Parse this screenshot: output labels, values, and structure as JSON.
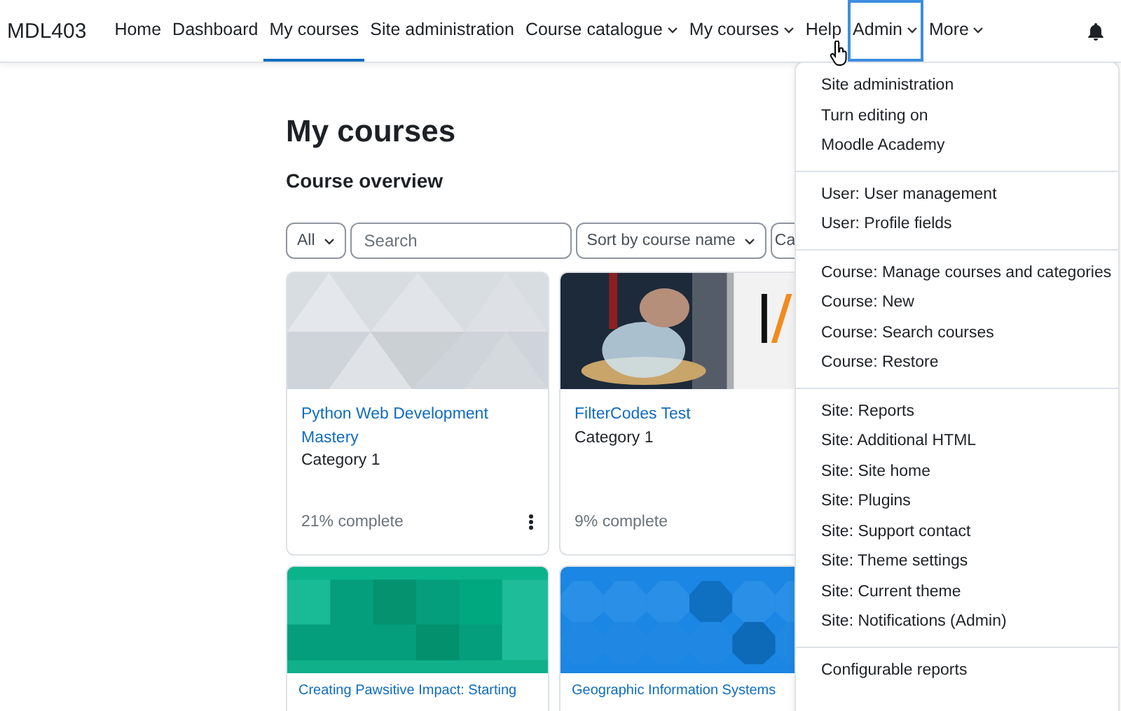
{
  "brand": "MDL403",
  "nav": [
    {
      "label": "Home",
      "dropdown": false,
      "selected": false,
      "focused": false
    },
    {
      "label": "Dashboard",
      "dropdown": false,
      "selected": false,
      "focused": false
    },
    {
      "label": "My courses",
      "dropdown": false,
      "selected": true,
      "focused": false
    },
    {
      "label": "Site administration",
      "dropdown": false,
      "selected": false,
      "focused": false
    },
    {
      "label": "Course catalogue",
      "dropdown": true,
      "selected": false,
      "focused": false
    },
    {
      "label": "My courses",
      "dropdown": true,
      "selected": false,
      "focused": false
    },
    {
      "label": "Help",
      "dropdown": false,
      "selected": false,
      "focused": false
    },
    {
      "label": "Admin",
      "dropdown": true,
      "selected": false,
      "focused": true
    },
    {
      "label": "More",
      "dropdown": true,
      "selected": false,
      "focused": false
    }
  ],
  "page": {
    "title": "My courses",
    "subtitle": "Course overview"
  },
  "filters": [
    {
      "kind": "select",
      "label": "All"
    },
    {
      "kind": "search",
      "placeholder": "Search"
    },
    {
      "kind": "select",
      "label": "Sort by course name"
    },
    {
      "kind": "select",
      "label": "Ca"
    }
  ],
  "courses": [
    {
      "kind": "triangles",
      "title": "Python Web Development Mastery",
      "category": "Category 1",
      "progress": "21% complete"
    },
    {
      "title": "FilterCodes Test",
      "category": "Category 1",
      "progress": "9% complete"
    },
    {
      "kind": "squares",
      "title": "Creating Pawsitive Impact: Starting"
    },
    {
      "kind": "octagons",
      "title": "Geographic Information Systems"
    }
  ],
  "admin_menu": [
    [
      "Site administration",
      "Turn editing on",
      "Moodle Academy"
    ],
    [
      "User: User management",
      "User: Profile fields"
    ],
    [
      "Course: Manage courses and categories",
      "Course: New",
      "Course: Search courses",
      "Course: Restore"
    ],
    [
      "Site: Reports",
      "Site: Additional HTML",
      "Site: Site home",
      "Site: Plugins",
      "Site: Support contact",
      "Site: Theme settings",
      "Site: Current theme",
      "Site: Notifications (Admin)"
    ],
    [
      "Configurable reports"
    ]
  ]
}
